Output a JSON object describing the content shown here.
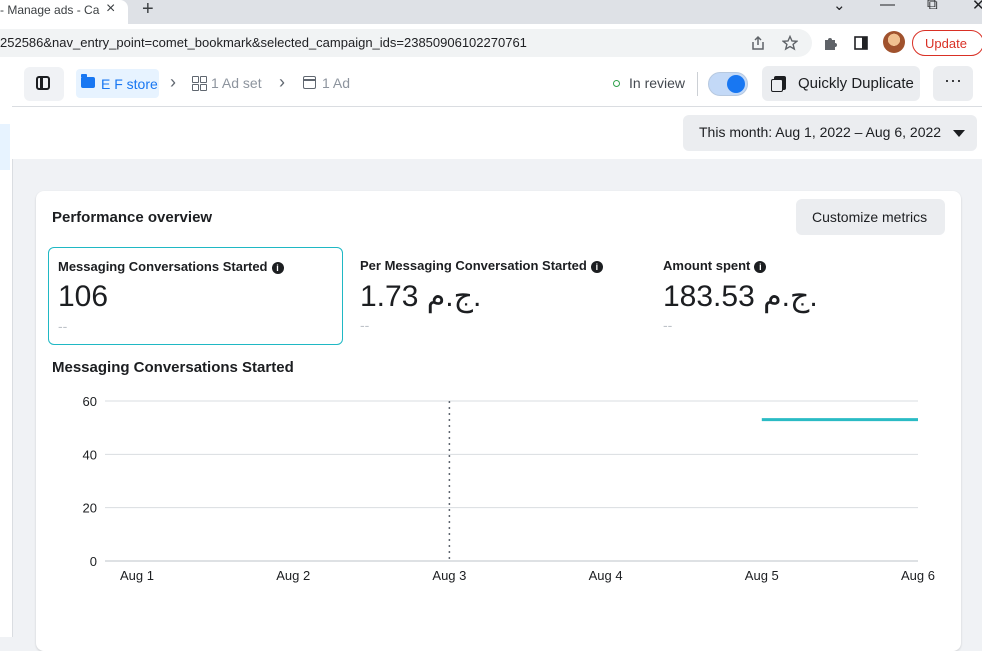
{
  "browser": {
    "tab_title": "- Manage ads - Ca",
    "tab_close": "×",
    "new_tab": "+",
    "url": "252586&nav_entry_point=comet_bookmark&selected_campaign_ids=23850906102270761",
    "update_label": "Update",
    "win_min": "⌄",
    "win_max": "—",
    "win_restore": "⧉",
    "win_close": "✕"
  },
  "header": {
    "breadcrumb_campaign": "E F store",
    "breadcrumb_adset": "1 Ad set",
    "breadcrumb_ad": "1 Ad",
    "chevron": "›",
    "status": "In review",
    "status_color": "#31a24c",
    "toggle_on": true,
    "duplicate_label": "Quickly Duplicate",
    "more_label": "···"
  },
  "date_range": {
    "label": "This month: Aug 1, 2022 – Aug 6, 2022"
  },
  "performance": {
    "title": "Performance overview",
    "customize_label": "Customize metrics",
    "metrics": [
      {
        "label": "Messaging Conversations Started",
        "value": "106",
        "delta": "--",
        "selected": true
      },
      {
        "label": "Per Messaging Conversation Started",
        "value": "1.73 ج.م.",
        "delta": "--",
        "selected": false
      },
      {
        "label": "Amount spent",
        "value": "183.53 ج.م.",
        "delta": "--",
        "selected": false
      }
    ],
    "info_glyph": "i"
  },
  "chart_data": {
    "type": "line",
    "title": "Messaging Conversations Started",
    "categories": [
      "Aug 1",
      "Aug 2",
      "Aug 3",
      "Aug 4",
      "Aug 5",
      "Aug 6"
    ],
    "yticks": [
      0,
      20,
      40,
      60
    ],
    "ylim": [
      0,
      60
    ],
    "series": [
      {
        "values": [
          null,
          null,
          null,
          null,
          53,
          53
        ],
        "color": "#2abbc4"
      }
    ],
    "marker_category": "Aug 3",
    "grid": true
  }
}
